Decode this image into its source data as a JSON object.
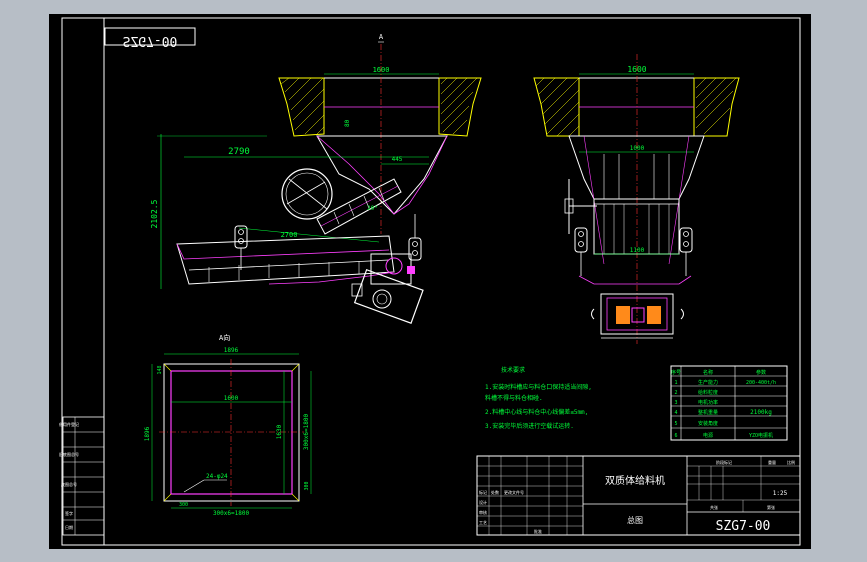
{
  "drawing_number": "SZG7-00",
  "section_marker": "A",
  "section_view_title": "A向",
  "dims_front": {
    "top_width": "1600",
    "horizontal_length": "2790",
    "offset": "445",
    "height": "2102.5",
    "trough_length": "2700",
    "small": "80",
    "angle": "20°"
  },
  "dims_side": {
    "top_width": "1600",
    "mid_width": "1000",
    "lower_width": "1100"
  },
  "dims_plan": {
    "overall_width": "1896",
    "edge": "148",
    "inner_width": "1600",
    "height_left": "1896",
    "height_inner": "1630",
    "pitch_right": "300x6=1800",
    "bolts": "24-φ24",
    "edge_300": "300",
    "bottom_300": "300",
    "pitch_bottom": "300x6=1800"
  },
  "notes": {
    "heading": "技术要求",
    "lines": [
      "1.安装时料槽应与料仓口保持适当间隙,",
      "  料槽不得与料仓相碰.",
      "2.料槽中心线与料仓中心线偏差≤5mm,",
      "3.安装完毕后须进行空载试运转."
    ]
  },
  "specs": {
    "header": [
      "序号",
      "名称",
      "参数"
    ],
    "rows": [
      [
        "1",
        "生产能力",
        "200-400t/h"
      ],
      [
        "2",
        "给料粒度",
        ""
      ],
      [
        "3",
        "电机功率",
        ""
      ],
      [
        "4",
        "整机重量",
        "2100kg"
      ],
      [
        "5",
        "安装角度",
        ""
      ],
      [
        "6",
        "电源",
        "YZO电振机"
      ]
    ]
  },
  "title_block": {
    "name": "双质体给料机",
    "drawing_type": "总图",
    "scale": "1:25",
    "drawing_number": "SZG7-00",
    "labels": [
      "标记",
      "处数",
      "更改文件号",
      "设计",
      "审核",
      "工艺",
      "批准"
    ],
    "right_labels": [
      "阶段标记",
      "重量",
      "比例",
      "共张",
      "第张"
    ]
  },
  "left_strip": {
    "labels": [
      "借用件登记",
      "旧底图总号",
      "底图总号",
      "签字",
      "日期"
    ]
  }
}
